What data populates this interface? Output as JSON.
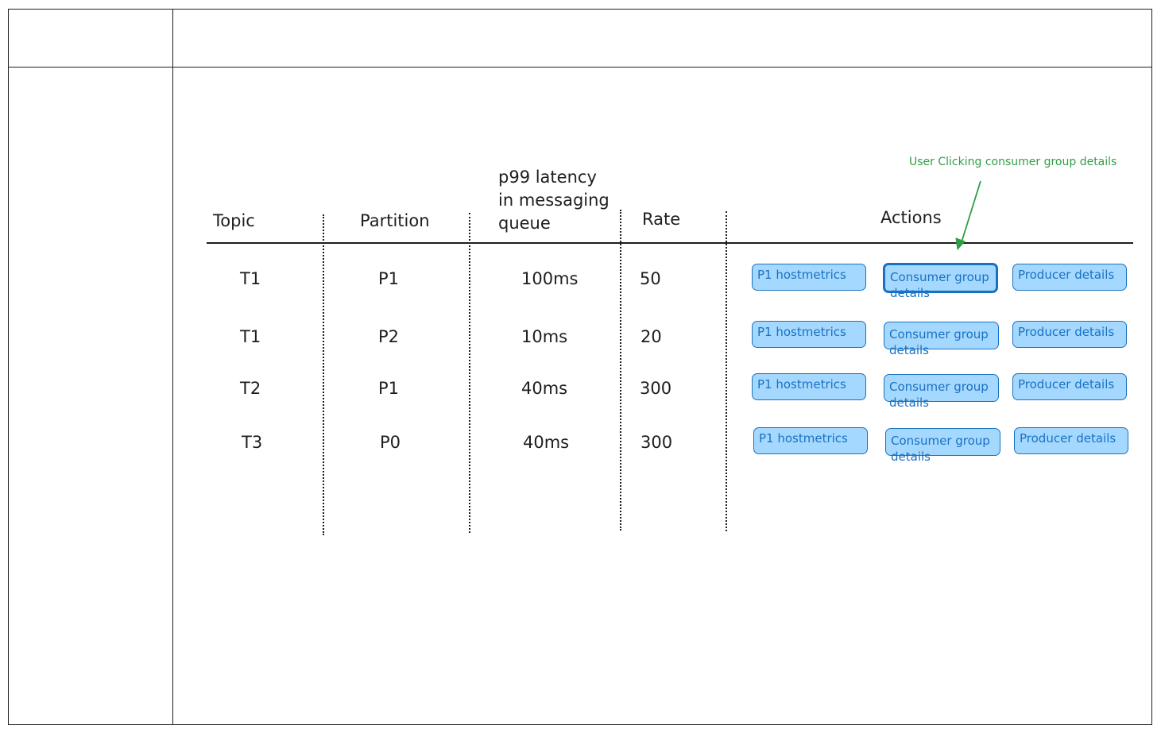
{
  "table": {
    "headers": {
      "topic": "Topic",
      "partition": "Partition",
      "latency_line1": "p99 latency",
      "latency_line2": "in messaging",
      "latency_line3": "queue",
      "rate": "Rate",
      "actions": "Actions"
    },
    "rows": [
      {
        "topic": "T1",
        "partition": "P1",
        "latency": "100ms",
        "rate": "50",
        "actions": {
          "hostmetrics": "P1 hostmetrics",
          "consumer_group": "Consumer group details",
          "producer": "Producer details"
        }
      },
      {
        "topic": "T1",
        "partition": "P2",
        "latency": "10ms",
        "rate": "20",
        "actions": {
          "hostmetrics": "P1 hostmetrics",
          "consumer_group": "Consumer group details",
          "producer": "Producer details"
        }
      },
      {
        "topic": "T2",
        "partition": "P1",
        "latency": "40ms",
        "rate": "300",
        "actions": {
          "hostmetrics": "P1 hostmetrics",
          "consumer_group": "Consumer group details",
          "producer": "Producer details"
        }
      },
      {
        "topic": "T3",
        "partition": "P0",
        "latency": "40ms",
        "rate": "300",
        "actions": {
          "hostmetrics": "P1 hostmetrics",
          "consumer_group": "Consumer group details",
          "producer": "Producer details"
        }
      }
    ]
  },
  "annotation": {
    "text": "User Clicking consumer group details",
    "color": "#2f9e44"
  },
  "colors": {
    "button_fill": "#a5d8ff",
    "button_stroke": "#1971c2",
    "ink": "#1e1e1e"
  }
}
